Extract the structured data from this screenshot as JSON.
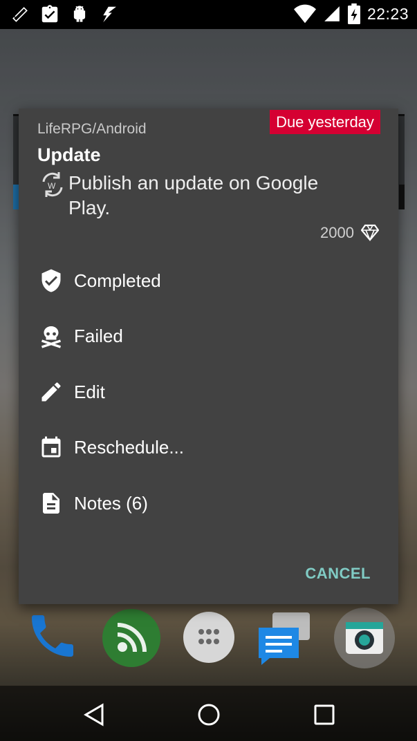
{
  "status_bar": {
    "time": "22:23",
    "icons_left": [
      "screen-rotation-icon",
      "clipboard-check-icon",
      "android-debug-icon",
      "flash-icon"
    ],
    "icons_right": [
      "wifi-icon",
      "signal-icon",
      "battery-charging-icon"
    ]
  },
  "dialog": {
    "due_badge": "Due yesterday",
    "project": "LifeRPG/Android",
    "title": "Update",
    "description": "Publish an update on Google Play.",
    "xp": "2000",
    "menu": [
      {
        "label": "Completed",
        "icon": "shield-check-icon"
      },
      {
        "label": "Failed",
        "icon": "skull-crossbones-icon"
      },
      {
        "label": "Edit",
        "icon": "pencil-icon"
      },
      {
        "label": "Reschedule...",
        "icon": "calendar-icon"
      },
      {
        "label": "Notes (6)",
        "icon": "document-icon"
      }
    ],
    "cancel": "CANCEL"
  },
  "dock": [
    "phone-icon",
    "rss-feed-icon",
    "app-drawer-icon",
    "messaging-icon",
    "camera-icon"
  ],
  "colors": {
    "due_badge": "#d50032",
    "dialog_bg": "#424242",
    "cancel": "#80cbc4"
  }
}
